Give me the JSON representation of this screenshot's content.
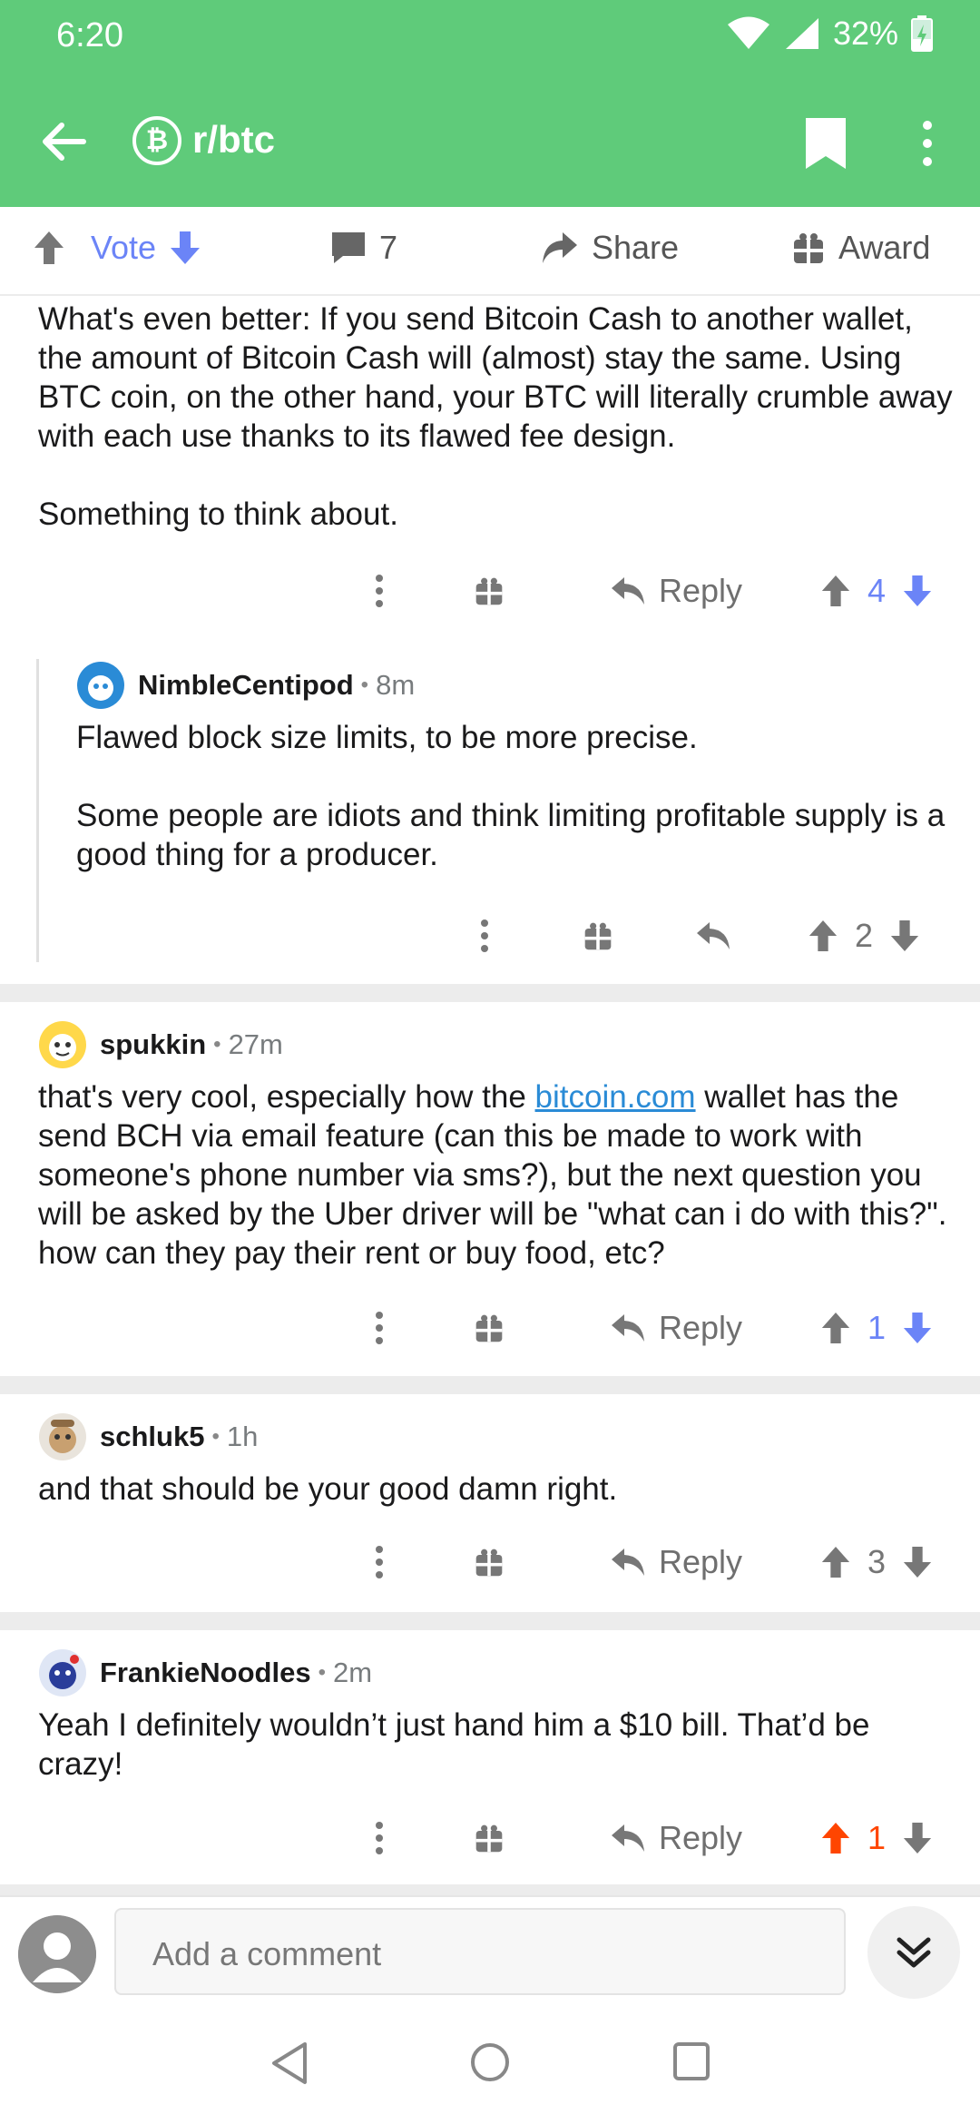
{
  "status": {
    "time": "6:20",
    "battery": "32%"
  },
  "header": {
    "subreddit": "r/btc",
    "sub_icon_glyph": "₿"
  },
  "actions": {
    "vote": "Vote",
    "comments_count": "7",
    "share": "Share",
    "award": "Award"
  },
  "comments": [
    {
      "paragraphs": [
        "What's even better: If you send Bitcoin Cash to another wallet, the amount of Bitcoin Cash will (almost) stay the same. Using BTC coin, on the other hand, your BTC will literally crumble away with each use thanks to its flawed fee design.",
        "Something to think about."
      ],
      "reply": "Reply",
      "score": "4"
    },
    {
      "user": "NimbleCentipod",
      "age": "8m",
      "paragraphs": [
        "Flawed block size limits, to be more precise.",
        "Some people are idiots and think limiting profitable supply is a good thing for a producer."
      ],
      "score": "2"
    },
    {
      "user": "spukkin",
      "age": "27m",
      "text_before_link": "that's very cool, especially how the ",
      "link": "bitcoin.com",
      "text_after_link": " wallet has the send BCH via email feature (can this be made to work with someone's phone number via sms?), but the next question you will be asked by the Uber driver will be \"what can i do with this?\".  how can they pay their rent or buy food, etc?",
      "reply": "Reply",
      "score": "1"
    },
    {
      "user": "schluk5",
      "age": "1h",
      "text": "and that should be your good damn right.",
      "reply": "Reply",
      "score": "3"
    },
    {
      "user": "FrankieNoodles",
      "age": "2m",
      "text": "Yeah I definitely wouldn’t just hand him a $10 bill. That’d be crazy!",
      "reply": "Reply",
      "score": "1"
    }
  ],
  "composer": {
    "placeholder": "Add a comment"
  },
  "colors": {
    "header_green": "#5fcb7a",
    "upvote_orange": "#ff4500",
    "downvote_blue": "#6b84f7",
    "link_blue": "#2a8bd6"
  }
}
